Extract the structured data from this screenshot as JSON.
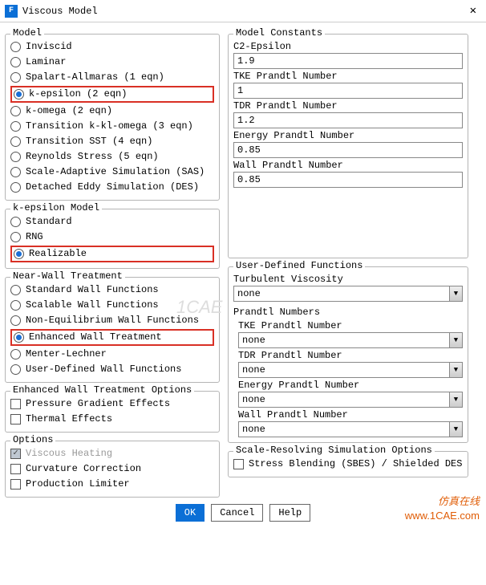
{
  "title": "Viscous Model",
  "groups": {
    "model": {
      "title": "Model",
      "items": [
        {
          "label": "Inviscid",
          "selected": false,
          "highlight": false
        },
        {
          "label": "Laminar",
          "selected": false,
          "highlight": false
        },
        {
          "label": "Spalart-Allmaras (1 eqn)",
          "selected": false,
          "highlight": false
        },
        {
          "label": "k-epsilon (2 eqn)",
          "selected": true,
          "highlight": true
        },
        {
          "label": "k-omega (2 eqn)",
          "selected": false,
          "highlight": false
        },
        {
          "label": "Transition k-kl-omega (3 eqn)",
          "selected": false,
          "highlight": false
        },
        {
          "label": "Transition SST (4 eqn)",
          "selected": false,
          "highlight": false
        },
        {
          "label": "Reynolds Stress (5 eqn)",
          "selected": false,
          "highlight": false
        },
        {
          "label": "Scale-Adaptive Simulation (SAS)",
          "selected": false,
          "highlight": false
        },
        {
          "label": "Detached Eddy Simulation (DES)",
          "selected": false,
          "highlight": false
        }
      ]
    },
    "ke_model": {
      "title": "k-epsilon Model",
      "items": [
        {
          "label": "Standard",
          "selected": false,
          "highlight": false
        },
        {
          "label": "RNG",
          "selected": false,
          "highlight": false
        },
        {
          "label": "Realizable",
          "selected": true,
          "highlight": true
        }
      ]
    },
    "near_wall": {
      "title": "Near-Wall Treatment",
      "items": [
        {
          "label": "Standard Wall Functions",
          "selected": false,
          "highlight": false
        },
        {
          "label": "Scalable Wall Functions",
          "selected": false,
          "highlight": false
        },
        {
          "label": "Non-Equilibrium Wall Functions",
          "selected": false,
          "highlight": false
        },
        {
          "label": "Enhanced Wall Treatment",
          "selected": true,
          "highlight": true
        },
        {
          "label": "Menter-Lechner",
          "selected": false,
          "highlight": false
        },
        {
          "label": "User-Defined Wall Functions",
          "selected": false,
          "highlight": false
        }
      ]
    },
    "ewt_options": {
      "title": "Enhanced Wall Treatment Options",
      "items": [
        {
          "label": "Pressure Gradient Effects",
          "checked": false,
          "disabled": false
        },
        {
          "label": "Thermal Effects",
          "checked": false,
          "disabled": false
        }
      ]
    },
    "options": {
      "title": "Options",
      "items": [
        {
          "label": "Viscous Heating",
          "checked": true,
          "disabled": true
        },
        {
          "label": "Curvature Correction",
          "checked": false,
          "disabled": false
        },
        {
          "label": "Production Limiter",
          "checked": false,
          "disabled": false
        }
      ]
    },
    "constants": {
      "title": "Model Constants",
      "items": [
        {
          "label": "C2-Epsilon",
          "value": "1.9"
        },
        {
          "label": "TKE Prandtl Number",
          "value": "1"
        },
        {
          "label": "TDR Prandtl Number",
          "value": "1.2"
        },
        {
          "label": "Energy Prandtl Number",
          "value": "0.85"
        },
        {
          "label": "Wall Prandtl Number",
          "value": "0.85"
        }
      ]
    },
    "udf": {
      "title": "User-Defined Functions",
      "turb_visc_label": "Turbulent Viscosity",
      "turb_visc_value": "none",
      "prandtl_title": "Prandtl Numbers",
      "prandtl": [
        {
          "label": "TKE Prandtl Number",
          "value": "none"
        },
        {
          "label": "TDR Prandtl Number",
          "value": "none"
        },
        {
          "label": "Energy Prandtl Number",
          "value": "none"
        },
        {
          "label": "Wall Prandtl Number",
          "value": "none"
        }
      ]
    },
    "srs": {
      "title": "Scale-Resolving Simulation Options",
      "label": "Stress Blending (SBES) / Shielded DES",
      "checked": false
    }
  },
  "buttons": {
    "ok": "OK",
    "cancel": "Cancel",
    "help": "Help"
  },
  "watermark": {
    "line1": "仿真在线",
    "line2": "www.1CAE.com"
  },
  "watermark_mid": "1CAE"
}
